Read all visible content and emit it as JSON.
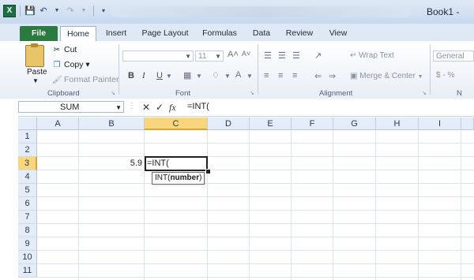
{
  "quick_access": {
    "logo": "X",
    "save_icon": "save-icon",
    "undo_icon": "undo-icon",
    "redo_icon": "redo-icon"
  },
  "window": {
    "title": "Book1 -"
  },
  "tabs": [
    {
      "label": "File"
    },
    {
      "label": "Home"
    },
    {
      "label": "Insert"
    },
    {
      "label": "Page Layout"
    },
    {
      "label": "Formulas"
    },
    {
      "label": "Data"
    },
    {
      "label": "Review"
    },
    {
      "label": "View"
    }
  ],
  "clipboard": {
    "paste": "Paste",
    "cut": "Cut",
    "copy": "Copy ▾",
    "format_painter": "Format Painter",
    "group": "Clipboard"
  },
  "font": {
    "size": "11",
    "bold": "B",
    "italic": "I",
    "underline": "U",
    "grow": "A˄",
    "shrink": "A˅",
    "group": "Font"
  },
  "alignment": {
    "wrap_text": "Wrap Text",
    "merge_center": "Merge & Center",
    "group": "Alignment"
  },
  "number": {
    "format": "General",
    "symbols": "$ - %",
    "group": "N"
  },
  "formula_bar": {
    "name_box": "SUM",
    "cancel": "✕",
    "enter": "✓",
    "fx": "fx",
    "formula": "=INT("
  },
  "columns": [
    "A",
    "B",
    "C",
    "D",
    "E",
    "F",
    "G",
    "H",
    "I"
  ],
  "rows": [
    "1",
    "2",
    "3",
    "4",
    "5",
    "6",
    "7",
    "8",
    "9",
    "10",
    "11"
  ],
  "cells": {
    "B3": "5.9",
    "C3": "=INT("
  },
  "tooltip": {
    "fn": "INT(",
    "arg": "number",
    "close": ")"
  },
  "colors": {
    "accent": "#2b7a3f",
    "selected_header": "#f8d67b"
  }
}
